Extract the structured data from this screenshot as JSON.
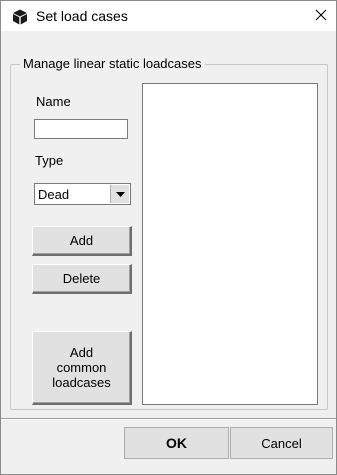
{
  "window": {
    "title": "Set load cases",
    "title_icon": "cube-icon",
    "close_icon": "close-icon"
  },
  "group": {
    "title": "Manage linear static loadcases"
  },
  "form": {
    "name_label": "Name",
    "name_value": "",
    "type_label": "Type",
    "type_selected": "Dead",
    "type_arrow_icon": "dropdown-arrow-icon"
  },
  "buttons": {
    "add": "Add",
    "delete": "Delete",
    "add_common_line1": "Add",
    "add_common_line2": "common",
    "add_common_line3": "loadcases",
    "ok": "OK",
    "cancel": "Cancel"
  },
  "loadcases": {
    "items": []
  }
}
